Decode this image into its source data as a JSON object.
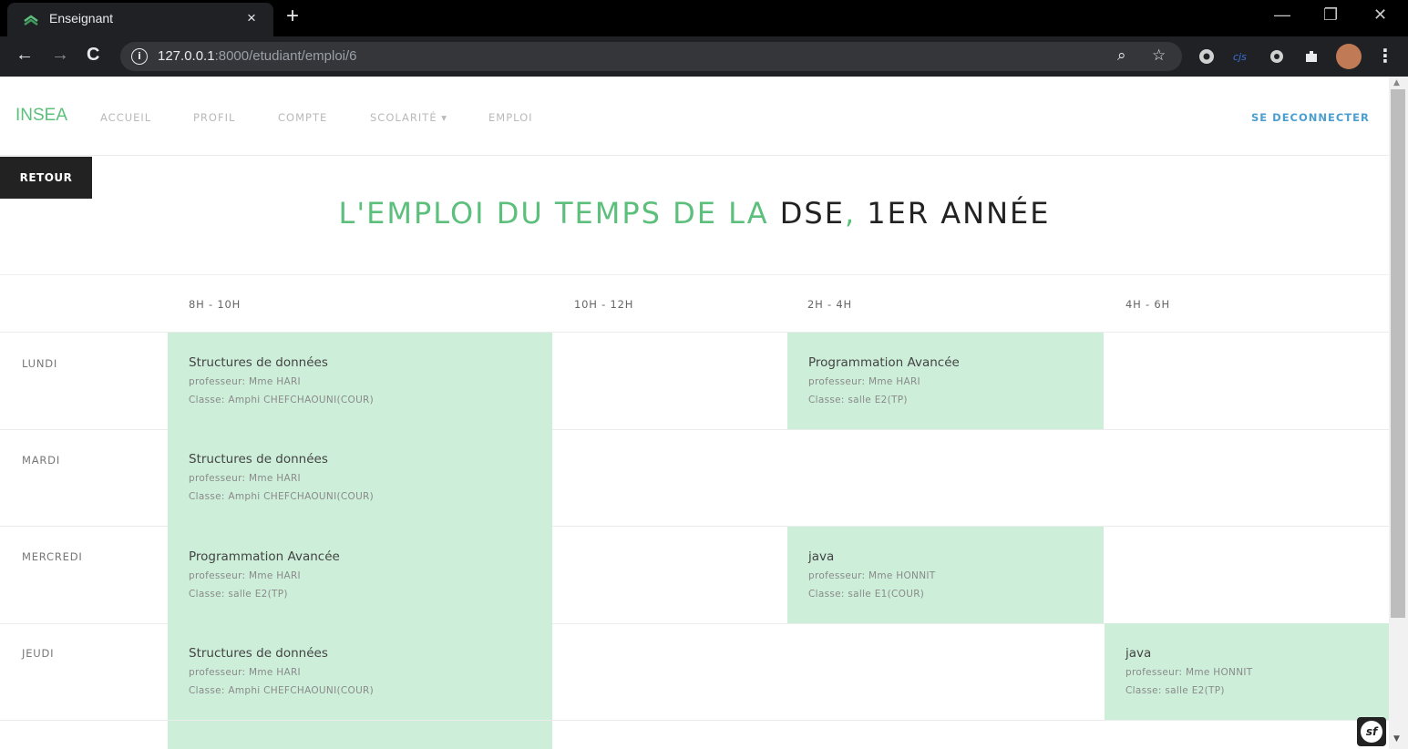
{
  "browser": {
    "tab_title": "Enseignant",
    "tab_close": "×",
    "new_tab": "+",
    "url_host": "127.0.0.1",
    "url_path": ":8000/etudiant/emploi/6",
    "minimize": "—",
    "restore": "❐",
    "close": "✕",
    "back": "←",
    "forward": "→",
    "reload": "C",
    "info": "i",
    "zoom_icon": "⌕",
    "star_icon": "☆",
    "menu": "⋮"
  },
  "navbar": {
    "brand": "INSEA",
    "links": [
      "ACCUEIL",
      "PROFIL",
      "COMPTE",
      "SCOLARITÉ ▾",
      "EMPLOI"
    ],
    "logout": "SE DECONNECTER"
  },
  "retour_label": "RETOUR",
  "title": {
    "prefix": "L'EMPLOI DU TEMPS DE LA ",
    "filiere": "DSE",
    "sep": ", ",
    "annee": "1ER ANNÉE"
  },
  "schedule": {
    "time_slots": [
      "8H - 10H",
      "10H - 12H",
      "2H - 4H",
      "4H - 6H"
    ],
    "days": [
      "LUNDI",
      "MARDI",
      "MERCREDI",
      "JEUDI"
    ],
    "entries": {
      "lundi_8": {
        "course": "Structures de données",
        "prof": "professeur: Mme HARI",
        "classe": "Classe: Amphi CHEFCHAOUNI(COUR)"
      },
      "lundi_2": {
        "course": "Programmation Avancée",
        "prof": "professeur: Mme HARI",
        "classe": "Classe: salle E2(TP)"
      },
      "mardi_8": {
        "course": "Structures de données",
        "prof": "professeur: Mme HARI",
        "classe": "Classe: Amphi CHEFCHAOUNI(COUR)"
      },
      "mercredi_8": {
        "course": "Programmation Avancée",
        "prof": "professeur: Mme HARI",
        "classe": "Classe: salle E2(TP)"
      },
      "mercredi_2": {
        "course": "java",
        "prof": "professeur: Mme HONNIT",
        "classe": "Classe: salle E1(COUR)"
      },
      "jeudi_8": {
        "course": "Structures de données",
        "prof": "professeur: Mme HARI",
        "classe": "Classe: Amphi CHEFCHAOUNI(COUR)"
      },
      "jeudi_4": {
        "course": "java",
        "prof": "professeur: Mme HONNIT",
        "classe": "Classe: salle E2(TP)"
      }
    }
  },
  "colors": {
    "accent": "#5cbf7b",
    "cell_bg": "#cdeed9",
    "link_blue": "#4a9fd0"
  },
  "icons": [
    "leaf-favicon",
    "info-icon",
    "zoom-icon",
    "star-icon",
    "extension-icons",
    "profile-avatar",
    "symfony-toolbar-icon"
  ]
}
